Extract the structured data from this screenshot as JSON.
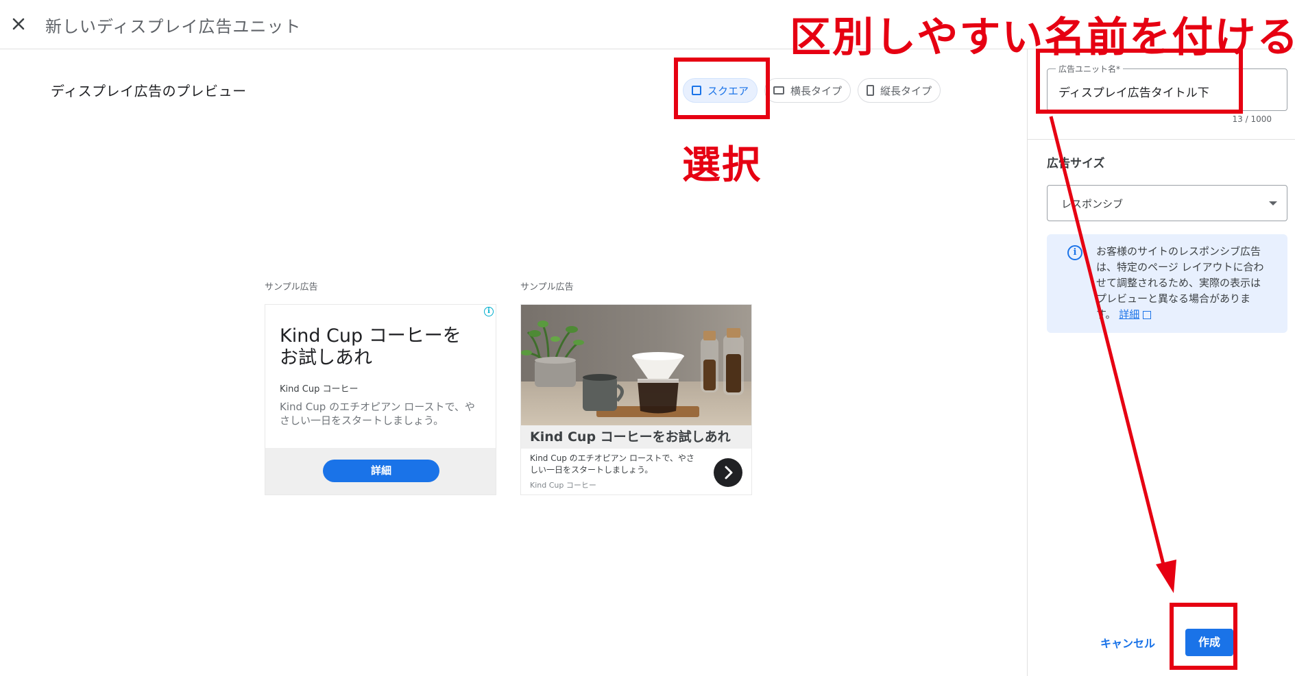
{
  "header": {
    "title": "新しいディスプレイ広告ユニット"
  },
  "preview": {
    "title": "ディスプレイ広告のプレビュー",
    "tabs": [
      {
        "label": "スクエア",
        "icon": "square-icon",
        "active": true
      },
      {
        "label": "横長タイプ",
        "icon": "landscape-icon",
        "active": false
      },
      {
        "label": "縦長タイプ",
        "icon": "portrait-icon",
        "active": false
      }
    ],
    "ads": [
      {
        "sample_label": "サンプル広告",
        "headline": "Kind Cup コーヒーを お試しあれ",
        "brand": "Kind Cup コーヒー",
        "description": "Kind Cup のエチオピアン ローストで、やさしい一日をスタートしましょう。",
        "cta": "詳細",
        "info_glyph": "i"
      },
      {
        "sample_label": "サンプル広告",
        "headline": "Kind Cup コーヒーをお試しあれ",
        "description": "Kind Cup のエチオピアン ローストで、やさしい一日をスタートしましょう。",
        "brand": "Kind Cup コーヒー"
      }
    ]
  },
  "panel": {
    "name_field": {
      "label": "広告ユニット名*",
      "value": "ディスプレイ広告タイトル下",
      "count": "13 / 1000"
    },
    "size": {
      "label": "広告サイズ",
      "value": "レスポンシブ"
    },
    "info": {
      "text": "お客様のサイトのレスポンシブ広告は、特定のページ レイアウトに合わせて調整されるため、実際の表示はプレビューと異なる場合があります。",
      "link": "詳細",
      "icon_glyph": "i"
    },
    "cancel": "キャンセル",
    "create": "作成"
  },
  "annotations": {
    "title": "区別しやすい名前を付ける",
    "select": "選択",
    "color": "#e60012"
  },
  "colors": {
    "accent": "#1a73e8",
    "active_tab_bg": "#e8f0fe"
  }
}
